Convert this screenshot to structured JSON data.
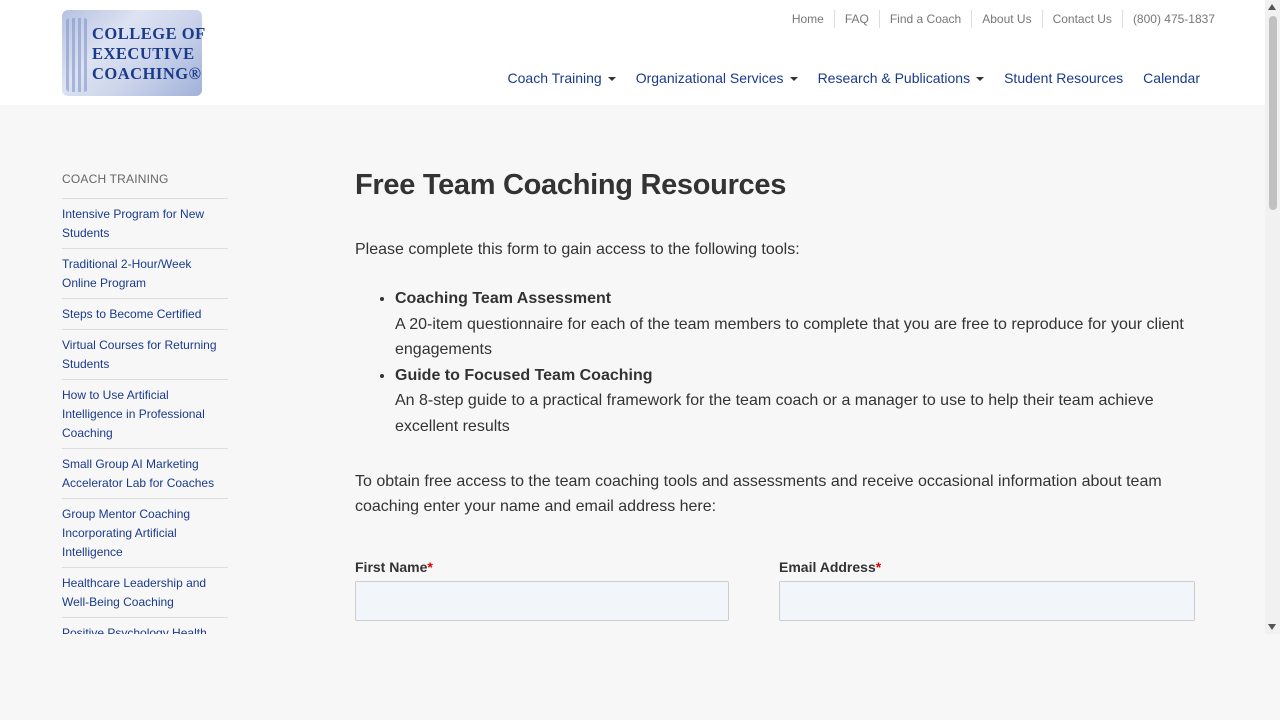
{
  "logo": {
    "line1": "COLLEGE OF",
    "line2": "EXECUTIVE",
    "line3": "COACHING®"
  },
  "utility_nav": [
    "Home",
    "FAQ",
    "Find a Coach",
    "About Us",
    "Contact Us",
    "(800) 475-1837"
  ],
  "main_nav": [
    {
      "label": "Coach Training",
      "dropdown": true
    },
    {
      "label": "Organizational Services",
      "dropdown": true
    },
    {
      "label": "Research & Publications",
      "dropdown": true
    },
    {
      "label": "Student Resources",
      "dropdown": false
    },
    {
      "label": "Calendar",
      "dropdown": false
    }
  ],
  "sidebar": {
    "heading": "COACH TRAINING",
    "items": [
      "Intensive Program for New Students",
      "Traditional 2-Hour/Week Online Program",
      "Steps to Become Certified",
      "Virtual Courses for Returning Students",
      "How to Use Artificial Intelligence in Professional Coaching",
      "Small Group AI Marketing Accelerator Lab for Coaches",
      "Group Mentor Coaching Incorporating Artificial Intelligence",
      "Healthcare Leadership and Well-Being Coaching",
      "Positive Psychology Health"
    ]
  },
  "main": {
    "title": "Free Team Coaching Resources",
    "intro": "Please complete this form to gain access to the following tools:",
    "tools": [
      {
        "name": "Coaching Team Assessment",
        "desc": "A 20-item questionnaire for each of the team members to complete that you are free to reproduce for your client engagements"
      },
      {
        "name": "Guide to Focused Team Coaching",
        "desc": "An 8-step guide to a practical framework for the team coach or a manager to use to help their team achieve excellent results"
      }
    ],
    "obtain": "To obtain free access to the team coaching tools and assessments and receive occasional information about team coaching enter your name and email address here:",
    "form": {
      "first_name_label": "First Name",
      "email_label": "Email Address",
      "required_mark": "*",
      "first_name_value": "",
      "email_value": ""
    }
  },
  "colors": {
    "link": "#1a3a8c",
    "required": "#dd0000",
    "background": "#f7f7f7"
  }
}
